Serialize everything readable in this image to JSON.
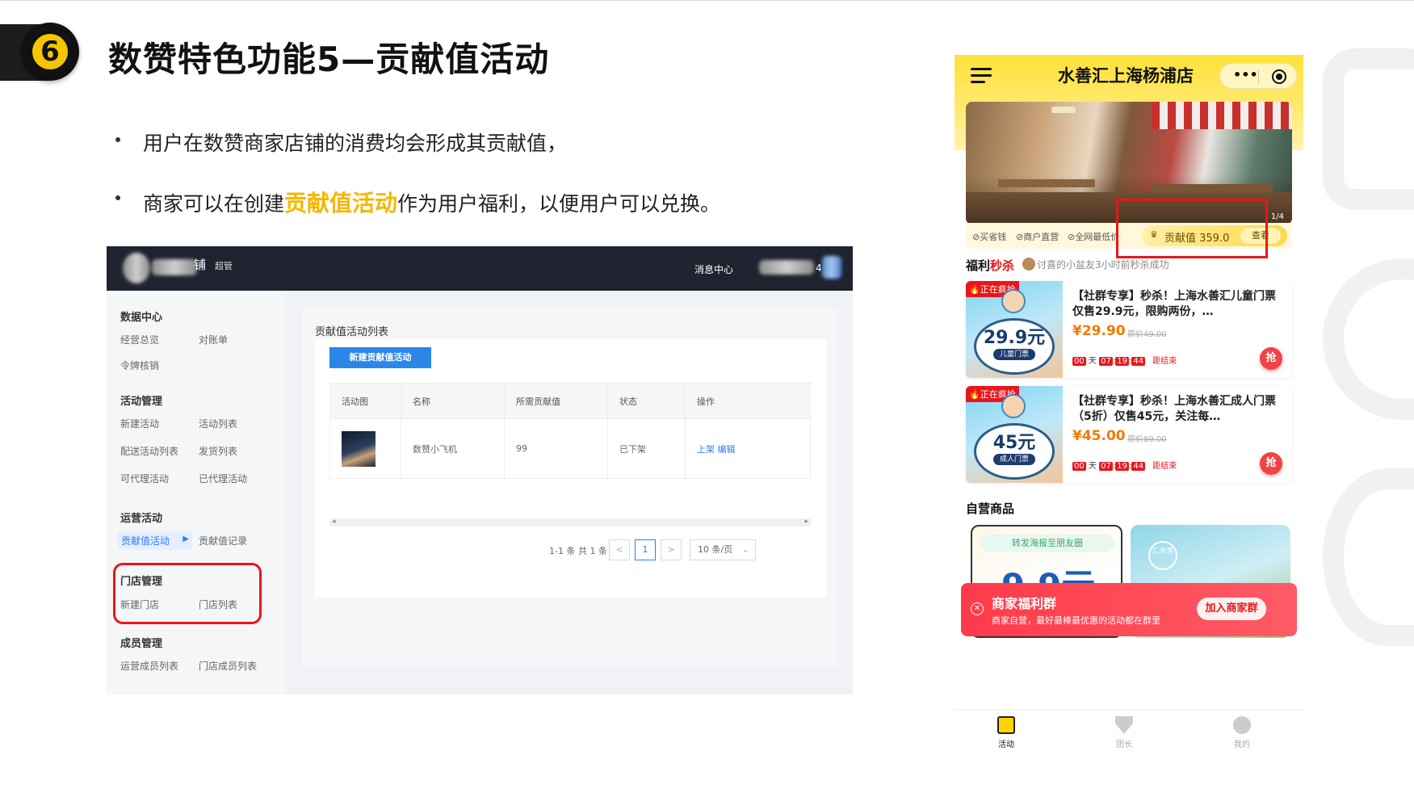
{
  "slide": {
    "title": "数赞特色功能5—贡献值活动",
    "logo_glyph": "6",
    "bullets": [
      {
        "text": "用户在数赞商家店铺的消费均会形成其贡献值，"
      },
      {
        "pre": "商家可以在创建",
        "highlight": "贡献值活动",
        "post": "作为用户福利，以便用户可以兑换。"
      }
    ],
    "highlight_color": "#f6b600"
  },
  "admin": {
    "header": {
      "shop_name_suffix": "铺",
      "shop_tag": "超管",
      "message_center": "消息中心",
      "user_suffix": "4"
    },
    "sidebar": {
      "groups": [
        {
          "label": "数据中心",
          "items": [
            "经营总览",
            "对账单",
            "令牌核销"
          ]
        },
        {
          "label": "活动管理",
          "items": [
            "新建活动",
            "活动列表",
            "配送活动列表",
            "发货列表",
            "可代理活动",
            "已代理活动"
          ]
        },
        {
          "label": "运营活动",
          "items": [
            "贡献值活动",
            "贡献值记录"
          ]
        },
        {
          "label": "门店管理",
          "items": [
            "新建门店",
            "门店列表"
          ]
        },
        {
          "label": "成员管理",
          "items": [
            "运营成员列表",
            "门店成员列表"
          ]
        }
      ]
    },
    "main": {
      "list_title": "贡献值活动列表",
      "new_button": "新建贡献值活动",
      "table": {
        "headers": [
          "活动图",
          "名称",
          "所需贡献值",
          "状态",
          "操作"
        ],
        "rows": [
          {
            "name": "数赞小飞机",
            "required": "99",
            "status": "已下架",
            "actions": [
              "上架",
              "编辑"
            ]
          }
        ]
      },
      "pagination": {
        "total": "1-1 条 共 1 条",
        "prev": "<",
        "page": "1",
        "next": ">",
        "page_size": "10 条/页"
      }
    }
  },
  "mobile": {
    "title": "水善汇上海杨浦店",
    "capsule_dots": "•••",
    "banner_counter": "1/4",
    "features": [
      "⊘买省钱",
      "⊘商户直营",
      "⊘全网最低价"
    ],
    "contribution_label": "贡献值 359.0",
    "view_button": "查看",
    "flash_title_a": "福利",
    "flash_title_b": "秒杀",
    "flash_note": "讨喜的小盆友3小时前秒杀成功",
    "deals": [
      {
        "hot": "🔥正在疯抢",
        "img_price": "29.9元",
        "img_tag": "儿童门票",
        "title": "【社群专享】秒杀！上海水善汇儿童门票仅售29.9元，限购两份，…",
        "price": "¥29.90",
        "orig_price": "原价49.00",
        "cd_days": "00",
        "cd_h": "07",
        "cd_m": "19",
        "cd_s": "44",
        "cd_day_label": "天",
        "end_label": "距结束",
        "grab": "抢"
      },
      {
        "hot": "🔥正在疯抢",
        "img_price": "45元",
        "img_tag": "成人门票",
        "title": "【社群专享】秒杀！上海水善汇成人门票（5折）仅售45元，关注每…",
        "price": "¥45.00",
        "orig_price": "原价89.00",
        "cd_days": "00",
        "cd_h": "07",
        "cd_m": "19",
        "cd_s": "44",
        "cd_day_label": "天",
        "end_label": "距结束",
        "grab": "抢"
      }
    ],
    "self_title": "自营商品",
    "product1_share": "转发海报至朋友圈",
    "product1_price": "9.9元",
    "product2_stamp": "汇水善",
    "float_banner": {
      "close": "✕",
      "title": "商家福利群",
      "subtitle": "商家自营，最好最棒最优惠的活动都在群里",
      "button": "加入商家群"
    },
    "tabs": [
      "活动",
      "团长",
      "我的"
    ]
  }
}
